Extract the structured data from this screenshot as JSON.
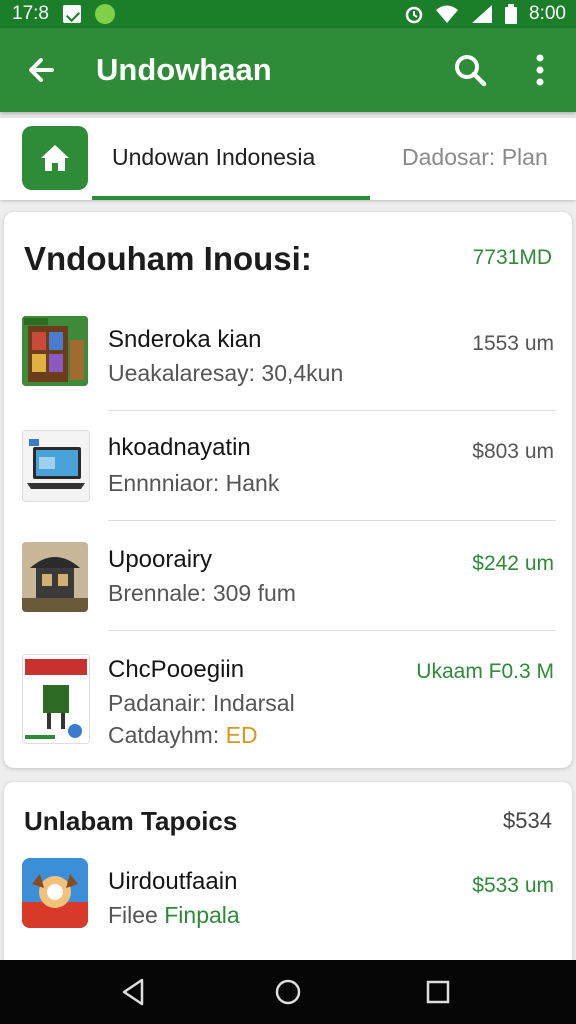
{
  "status": {
    "time_left": "17:8",
    "time_right": "8:00"
  },
  "appbar": {
    "title": "Undowhaan"
  },
  "tabs": [
    {
      "label": "Undowan Indonesia"
    },
    {
      "label": "Dadosar: Plan"
    }
  ],
  "card1": {
    "title": "Vndouham Inousi:",
    "amount": "7731MD",
    "items": [
      {
        "name": "Snderoka kian",
        "sub": "Ueakalaresay: 30,4kun",
        "price": "1553 um",
        "price_color": "#555555"
      },
      {
        "name": "hkoadnayatin",
        "sub": "Ennnniaor: Hank",
        "price": "$803 um",
        "price_color": "#555555"
      },
      {
        "name": "Upoorairy",
        "sub": "Brennale: 309 fum",
        "price": "$242 um",
        "price_color": "#2e8b37"
      },
      {
        "name": "ChcPooegiin",
        "sub": "Padanair: Indarsal",
        "sub2_label": "Catdayhm:",
        "sub2_value": "ED",
        "price": "Ukaam F0.3 M",
        "price_color": "#2e8b37"
      }
    ]
  },
  "card2": {
    "title": "Unlabam Tapoics",
    "amount": "$534",
    "items": [
      {
        "name": "Uirdoutfaain",
        "sub_label": "Filee",
        "sub_value": "Finpala",
        "price": "$533 um"
      }
    ]
  },
  "colors": {
    "primary": "#2e8b37",
    "status": "#1b7f2a",
    "accent_orange": "#d49a1d"
  },
  "icons": [
    "back-arrow-icon",
    "search-icon",
    "more-vert-icon",
    "home-icon",
    "nav-back-icon",
    "nav-home-icon",
    "nav-recents-icon"
  ]
}
